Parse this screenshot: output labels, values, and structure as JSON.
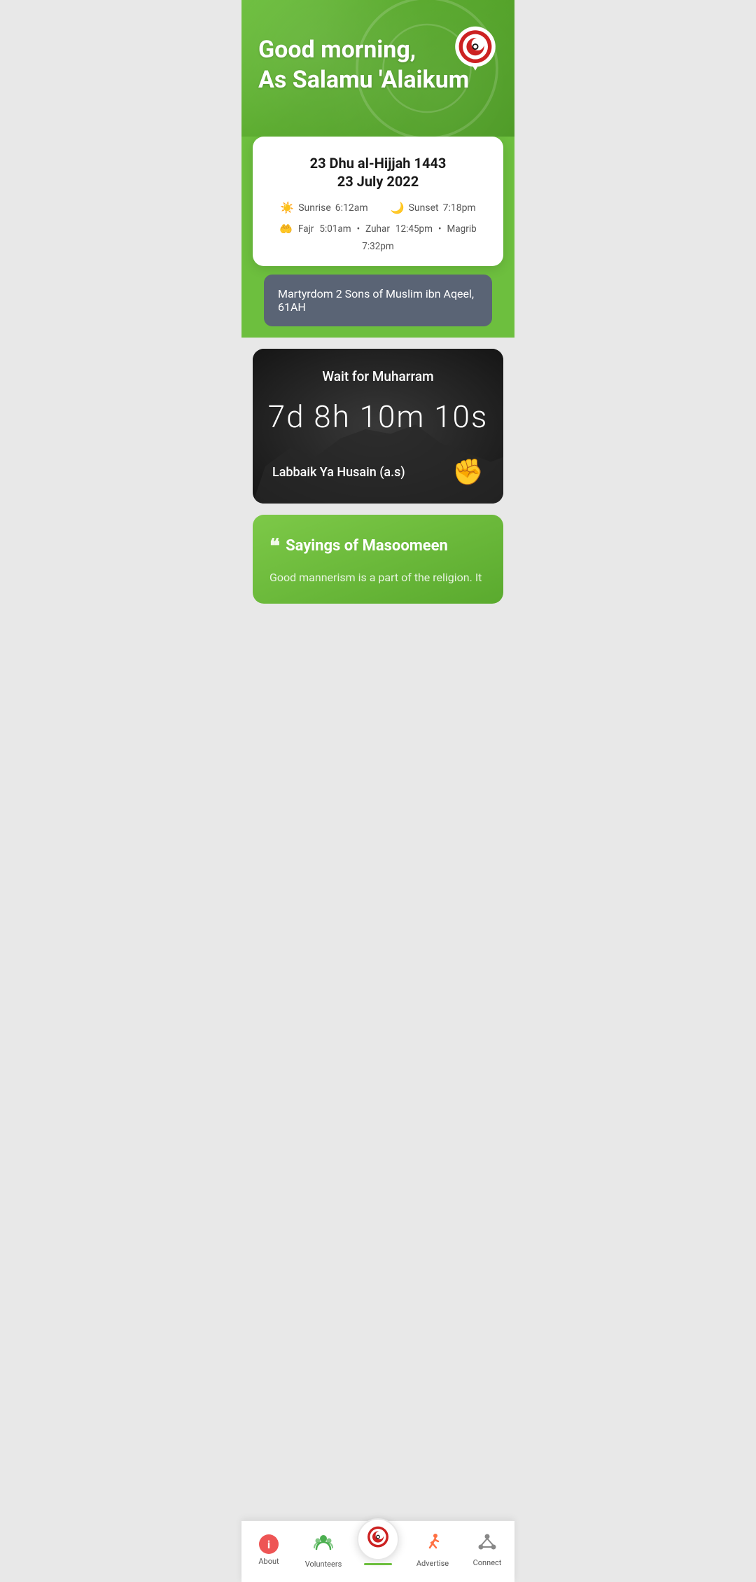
{
  "hero": {
    "greeting_line1": "Good morning,",
    "greeting_line2": "As Salamu 'Alaikum"
  },
  "date_card": {
    "islamic_date": "23 Dhu al-Hijjah 1443",
    "gregorian_date": "23 July 2022",
    "sunrise_label": "Sunrise",
    "sunrise_time": "6:12am",
    "sunset_label": "Sunset",
    "sunset_time": "7:18pm",
    "fajr_label": "Fajr",
    "fajr_time": "5:01am",
    "zuhar_label": "Zuhar",
    "zuhar_time": "12:45pm",
    "magrib_label": "Magrib",
    "magrib_time": "7:32pm"
  },
  "event_banner": {
    "text": "Martyrdom 2 Sons of Muslim ibn Aqeel, 61AH"
  },
  "countdown": {
    "title": "Wait for Muharram",
    "timer": "7d 8h 10m 10s",
    "slogan": "Labbaik Ya Husain (a.s)"
  },
  "sayings": {
    "title": "Sayings of Masoomeen",
    "text": "Good mannerism is a part of the religion. It"
  },
  "nav": {
    "about_label": "About",
    "volunteers_label": "Volunteers",
    "advertise_label": "Advertise",
    "connect_label": "Connect"
  }
}
